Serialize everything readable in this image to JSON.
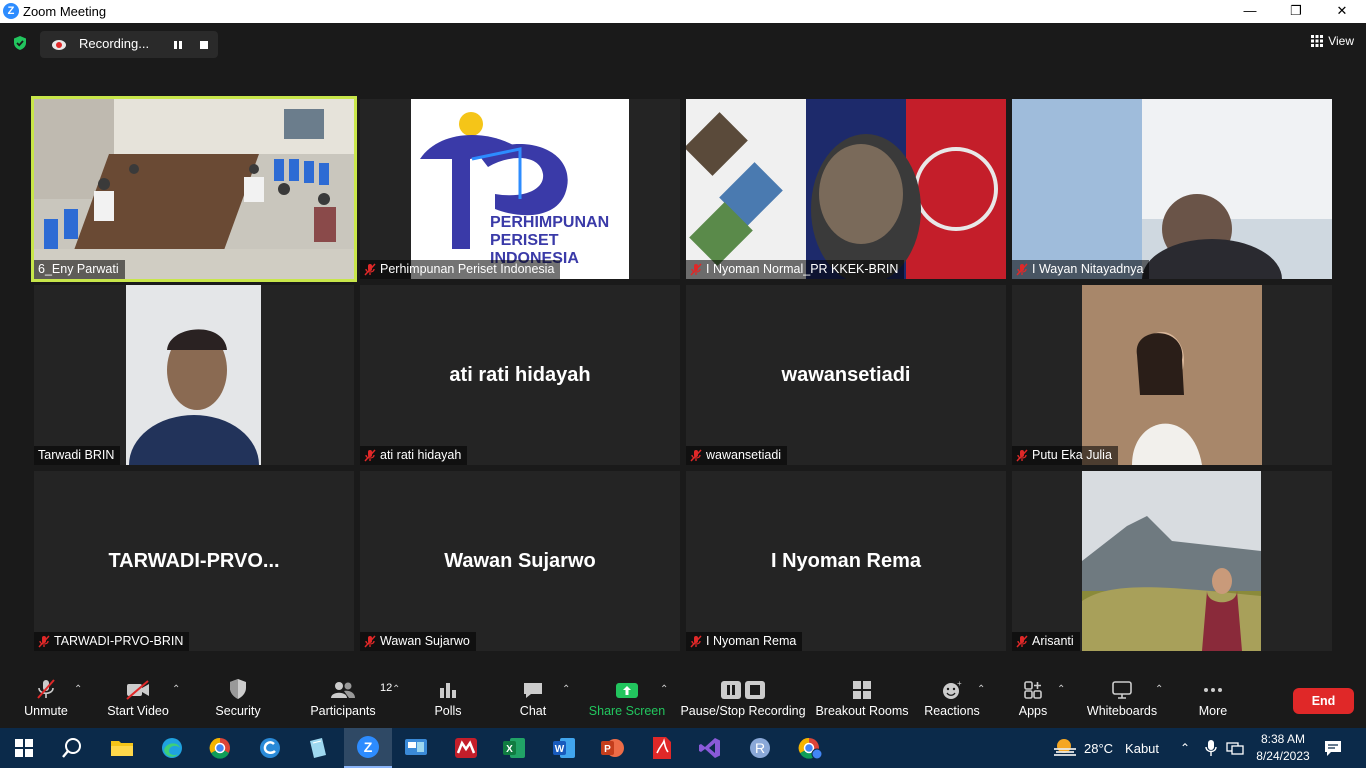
{
  "window": {
    "title": "Zoom Meeting",
    "controls": [
      "—",
      "❐",
      "✕"
    ]
  },
  "recording": {
    "label": "Recording..."
  },
  "view_button": {
    "label": "View"
  },
  "tiles": [
    {
      "name": "6_Eny Parwati",
      "muted": false,
      "active": true,
      "display_text": ""
    },
    {
      "name": "Perhimpunan Periset Indonesia",
      "muted": true,
      "active": false,
      "display_text": ""
    },
    {
      "name": "I Nyoman Normal_PR KKEK-BRIN",
      "muted": true,
      "active": false,
      "display_text": ""
    },
    {
      "name": "I Wayan Nitayadnya",
      "muted": true,
      "active": false,
      "display_text": ""
    },
    {
      "name": "Tarwadi BRIN",
      "muted": false,
      "active": false,
      "display_text": ""
    },
    {
      "name": "ati rati hidayah",
      "muted": true,
      "active": false,
      "display_text": "ati rati hidayah"
    },
    {
      "name": "wawansetiadi",
      "muted": true,
      "active": false,
      "display_text": "wawansetiadi"
    },
    {
      "name": "Putu Eka Julia",
      "muted": true,
      "active": false,
      "display_text": ""
    },
    {
      "name": "TARWADI-PRVO-BRIN",
      "muted": true,
      "active": false,
      "display_text": "TARWADI-PRVO..."
    },
    {
      "name": "Wawan Sujarwo",
      "muted": true,
      "active": false,
      "display_text": "Wawan Sujarwo"
    },
    {
      "name": "I Nyoman Rema",
      "muted": true,
      "active": false,
      "display_text": "I Nyoman Rema"
    },
    {
      "name": "Arisanti",
      "muted": true,
      "active": false,
      "display_text": ""
    }
  ],
  "logo": {
    "line1": "PERHIMPUNAN",
    "line2": "PERISET",
    "line3": "INDONESIA"
  },
  "toolbar": {
    "unmute": "Unmute",
    "start_video": "Start Video",
    "security": "Security",
    "participants": "Participants",
    "participants_count": "12",
    "polls": "Polls",
    "chat": "Chat",
    "share_screen": "Share Screen",
    "pause_stop": "Pause/Stop Recording",
    "breakout": "Breakout Rooms",
    "reactions": "Reactions",
    "apps": "Apps",
    "whiteboards": "Whiteboards",
    "more": "More",
    "end": "End"
  },
  "taskbar": {
    "weather_temp": "28°C",
    "weather_text": "Kabut",
    "time": "8:38 AM",
    "date": "8/24/2023",
    "apps": [
      "start-icon",
      "search-icon",
      "file-explorer-icon",
      "edge-icon",
      "chrome-icon",
      "copilot-icon",
      "notepad-icon",
      "zoom-icon",
      "remote-desktop-icon",
      "mendeley-icon",
      "excel-icon",
      "word-icon",
      "powerpoint-icon",
      "acrobat-icon",
      "visual-studio-icon",
      "r-icon",
      "chrome-profile-icon"
    ]
  },
  "colors": {
    "active_speaker": "#c8e64a",
    "end_button": "#e02828",
    "share_green": "#22c55e",
    "taskbar": "#0b2a4a"
  }
}
